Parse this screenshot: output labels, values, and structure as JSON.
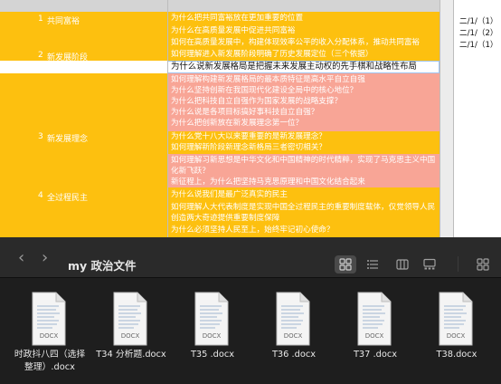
{
  "spreadsheet": {
    "sections": [
      {
        "num": "1",
        "title": "共同富裕"
      },
      {
        "num": "2",
        "title": "新发展阶段"
      },
      {
        "num": "3",
        "title": "新发展理念"
      },
      {
        "num": "4",
        "title": "全过程民主"
      }
    ],
    "rows": [
      "为什么把共同富裕放在更加重要的位置",
      "为什么在高质量发展中促进共同富裕",
      "如何在高质量发展中，构建体现效率公平的收入分配体系，推动共同富裕",
      "如何理解进入新发展阶段明确了历史发展定位（三个依据）",
      "为什么说新发展格局是把握未来发展主动权的先手棋和战略性布局",
      "如何理解构建新发展格局的最本质特征是高水平自立自强",
      "为什么坚持创新在我国现代化建设全局中的核心地位？",
      "为什么把科技自立自强作为国家发展的战略支撑？",
      "为什么说是各项目标搞好事科技自立自强？",
      "为什么把创新放在新发展理念第一位？",
      "为什么党十八大以来要重要的是新发展理念？",
      "如何理解新阶段新理念新格局三者密切相关？",
      "如何理解习新思想是中华文化和中国精神的时代精粹，实现了马克思主义中国化新飞跃？",
      "新征程上，为什么把坚持马克思原理和中国文化结合起来",
      "为什么说我们是最广泛真实的民主",
      "如何理解人大代表制度是实现中国全过程民主的重要制度载体，仅觉领导人民创造两大奇迹提供重要制度保障",
      "为什么必须坚持人民至上，始终牢记初心使命？"
    ],
    "right_column": [
      "二/1/（1）",
      "二/1/（2）",
      "二/1/（1）"
    ]
  },
  "finder": {
    "title": "my 政治文件",
    "back_icon": "chevron-left-icon",
    "forward_icon": "chevron-right-icon",
    "view_buttons": [
      "icon-view",
      "list-view",
      "column-view",
      "gallery-view",
      "group-menu"
    ],
    "doc_badge": "DOCX",
    "files": [
      {
        "name_lines": [
          "时政抖八四（选择",
          "整理）.docx"
        ]
      },
      {
        "name_lines": [
          "T34 分析题.docx"
        ]
      },
      {
        "name_lines": [
          "T35 .docx"
        ]
      },
      {
        "name_lines": [
          "T36 .docx"
        ]
      },
      {
        "name_lines": [
          "T37 .docx"
        ]
      },
      {
        "name_lines": [
          "T38.docx"
        ]
      }
    ]
  },
  "colors": {
    "yellow": "#fdc00f",
    "salmon": "#f8a596",
    "finder_bg": "#1e1e1e"
  }
}
